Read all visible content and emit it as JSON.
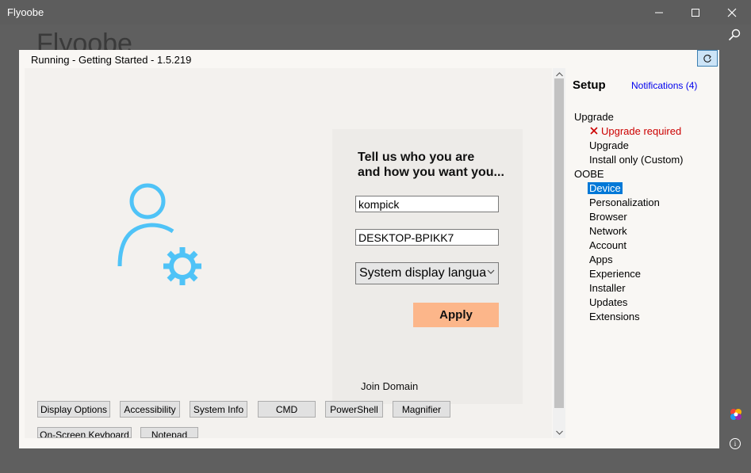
{
  "window": {
    "title": "Flyoobe",
    "background_title": "Flyoobe"
  },
  "status": {
    "text": "Running - Getting Started - 1.5.219"
  },
  "card": {
    "heading_line1": "Tell us who you are",
    "heading_line2": "and how you want you...",
    "username_value": "kompick",
    "computer_name_value": "DESKTOP-BPIKK7",
    "language_value": "System display langua",
    "apply_label": "Apply",
    "join_domain_label": "Join Domain"
  },
  "tools": {
    "display_options": "Display Options",
    "accessibility": "Accessibility",
    "system_info": "System Info",
    "cmd": "CMD",
    "powershell": "PowerShell",
    "magnifier": "Magnifier",
    "onscreen_keyboard": "On-Screen Keyboard",
    "notepad": "Notepad"
  },
  "sidebar": {
    "title": "Setup",
    "notifications": "Notifications (4)",
    "groups": {
      "upgrade": "Upgrade",
      "oobe": "OOBE"
    },
    "upgrade_items": {
      "required": "Upgrade required",
      "upgrade": "Upgrade",
      "install_only": "Install only (Custom)"
    },
    "oobe_items": {
      "device": "Device",
      "personalization": "Personalization",
      "browser": "Browser",
      "network": "Network",
      "account": "Account",
      "apps": "Apps",
      "experience": "Experience",
      "installer": "Installer",
      "updates": "Updates",
      "extensions": "Extensions"
    }
  },
  "colors": {
    "accent": "#0078d7",
    "apply_button": "#fcb68a",
    "user_icon": "#4fc3f7",
    "error": "#cc0000",
    "link": "#0000ee"
  },
  "icons": {
    "hero": "user-settings-icon",
    "refresh": "refresh-icon",
    "error": "close-icon",
    "search": "search-icon",
    "info": "info-icon"
  }
}
